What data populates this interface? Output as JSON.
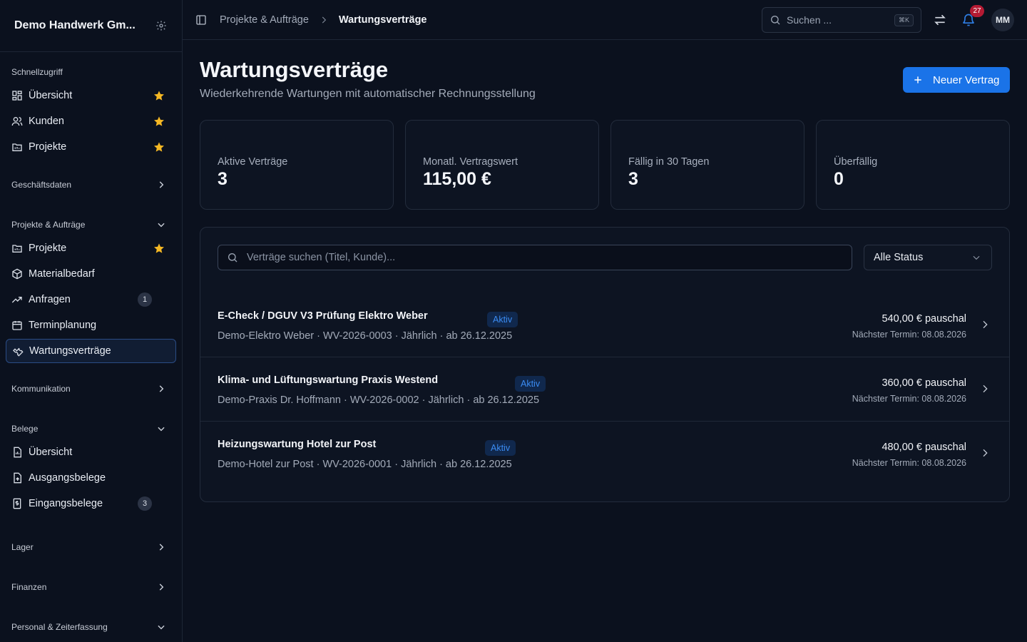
{
  "sidebar": {
    "company": "Demo Handwerk Gm...",
    "quick_label": "Schnellzugriff",
    "quick": [
      {
        "label": "Übersicht",
        "icon": "dashboard-icon"
      },
      {
        "label": "Kunden",
        "icon": "users-icon"
      },
      {
        "label": "Projekte",
        "icon": "folder-icon"
      }
    ],
    "business_label": "Geschäftsdaten",
    "projects_label": "Projekte & Aufträge",
    "projects": [
      {
        "label": "Projekte"
      },
      {
        "label": "Materialbedarf"
      },
      {
        "label": "Anfragen",
        "count": "1"
      },
      {
        "label": "Terminplanung"
      },
      {
        "label": "Wartungsverträge"
      }
    ],
    "communication_label": "Kommunikation",
    "docs_label": "Belege",
    "docs": [
      {
        "label": "Übersicht"
      },
      {
        "label": "Ausgangsbelege"
      },
      {
        "label": "Eingangsbelege",
        "count": "3"
      }
    ],
    "stock_label": "Lager",
    "finance_label": "Finanzen",
    "personnel_label": "Personal & Zeiterfassung"
  },
  "topbar": {
    "crumb_parent": "Projekte & Aufträge",
    "crumb_current": "Wartungsverträge",
    "search_placeholder": "Suchen ...",
    "search_kbd": "⌘K",
    "notification_count": "27",
    "avatar": "MM"
  },
  "page": {
    "title": "Wartungsverträge",
    "subtitle": "Wiederkehrende Wartungen mit automatischer Rechnungsstellung",
    "new_button": "Neuer Vertrag"
  },
  "stats": [
    {
      "label": "Aktive Verträge",
      "value": "3"
    },
    {
      "label": "Monatl. Vertragswert",
      "value": "115,00 €"
    },
    {
      "label": "Fällig in 30 Tagen",
      "value": "3"
    },
    {
      "label": "Überfällig",
      "value": "0"
    }
  ],
  "list": {
    "search_placeholder": "Verträge suchen (Titel, Kunde)...",
    "status_filter": "Alle Status",
    "contracts": [
      {
        "title": "E-Check / DGUV V3 Prüfung Elektro Weber",
        "status": "Aktiv",
        "meta": "Demo-Elektro Weber · WV-2026-0003 · Jährlich · ab 26.12.2025",
        "price": "540,00 € pauschal",
        "next": "Nächster Termin: 08.08.2026"
      },
      {
        "title": "Klima- und Lüftungswartung Praxis Westend",
        "status": "Aktiv",
        "meta": "Demo-Praxis Dr. Hoffmann · WV-2026-0002 · Jährlich · ab 26.12.2025",
        "price": "360,00 € pauschal",
        "next": "Nächster Termin: 08.08.2026"
      },
      {
        "title": "Heizungswartung Hotel zur Post",
        "status": "Aktiv",
        "meta": "Demo-Hotel zur Post · WV-2026-0001 · Jährlich · ab 26.12.2025",
        "price": "480,00 € pauschal",
        "next": "Nächster Termin: 08.08.2026"
      }
    ]
  },
  "colors": {
    "accent": "#1a73e8",
    "star": "#f5b824",
    "badge_text": "#3b8cf3",
    "notification": "#b41a33"
  }
}
